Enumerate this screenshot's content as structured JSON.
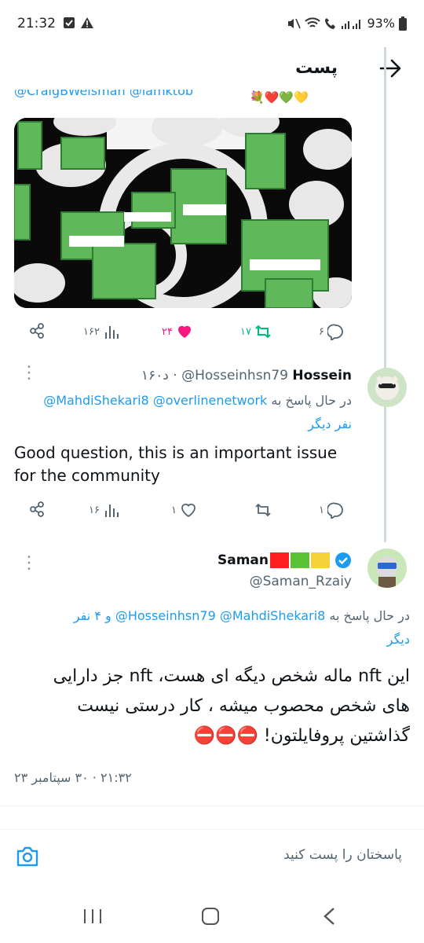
{
  "status": {
    "time": "21:32",
    "battery": "93%"
  },
  "header": {
    "title": "پست"
  },
  "top_tweet": {
    "cutoff_mentions": "@CraigBWeisman @iamktob",
    "stats": {
      "views": "۱۶۲",
      "likes": "۲۴",
      "retweets": "۱۷",
      "replies": "۶"
    }
  },
  "reply1": {
    "name": "Hossein",
    "handle": "@Hosseinhsn79",
    "time": "۱۶۰د",
    "replying_prefix": "در حال پاسخ به",
    "replying_to": "@MahdiShekari8 @overlinenetwork",
    "others": "نفر دیگر",
    "text": "Good question, this is an important issue for the community",
    "stats": {
      "views": "۱۶",
      "likes": "۱",
      "retweets": "",
      "replies": "۱"
    }
  },
  "main_tweet": {
    "name": "Saman",
    "handle": "@Saman_Rzaiy",
    "replying_prefix": "در حال پاسخ به",
    "replying_to": "@Hosseinhsn79 @MahdiShekari8",
    "replying_suffix": "و ۴ نفر",
    "others": "دیگر",
    "text_line1": "این nft ماله شخص دیگه ای هست، nft جز دارایی",
    "text_line2": "های شخص محصوب میشه ، کار درستی نیست",
    "text_line3": "گذاشتین پروفایلتون! ⛔⛔⛔",
    "timestamp": "۲۱:۳۲ · ۳۰ سپتامبر ۲۳"
  },
  "compose": {
    "placeholder": "پاسختان را پست کنید"
  },
  "colors": {
    "accent": "#1d9bf0",
    "like": "#f91880",
    "retweet": "#00ba7c",
    "muted": "#536471"
  }
}
